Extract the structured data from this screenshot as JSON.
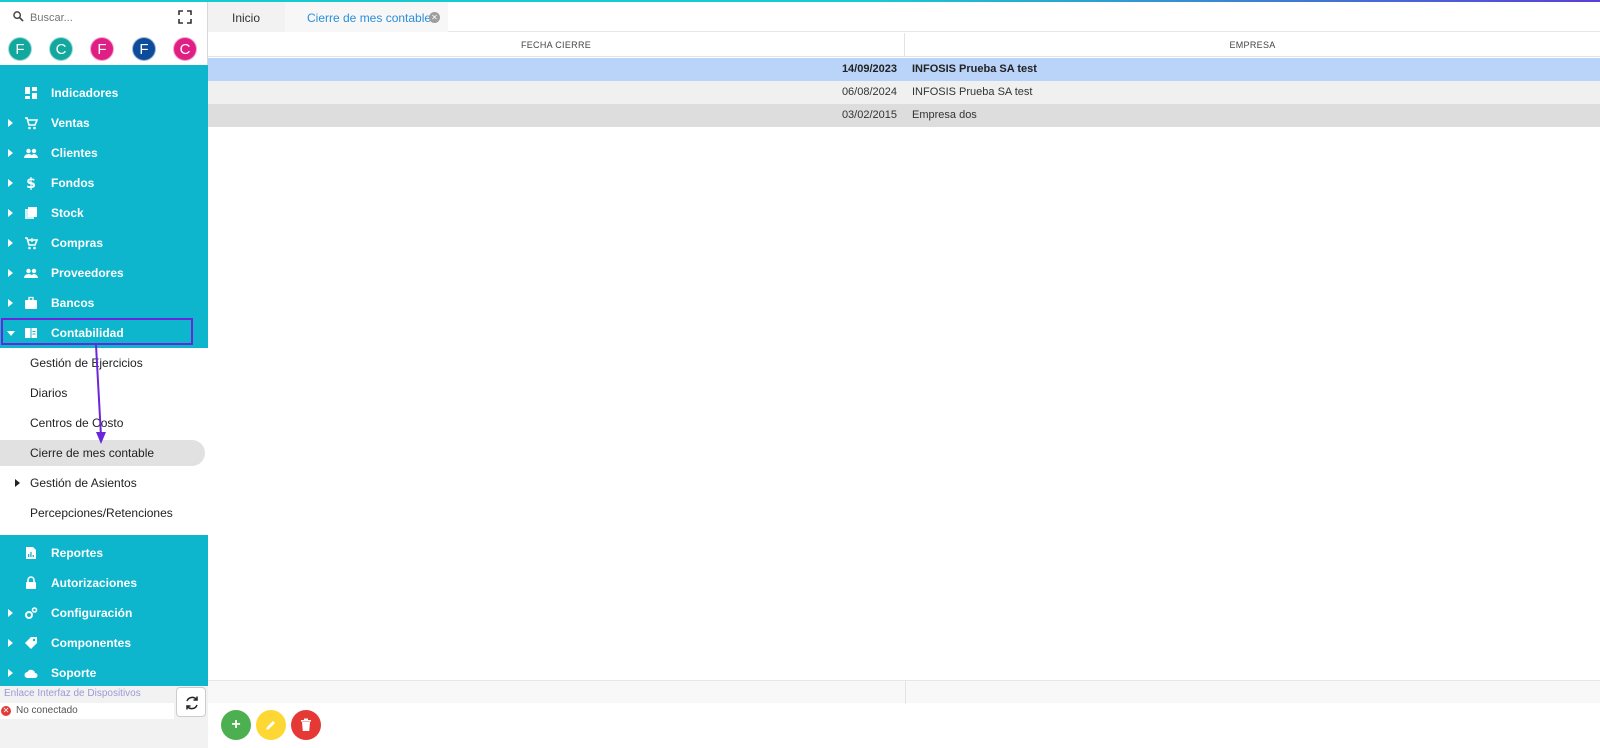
{
  "search": {
    "placeholder": "Buscar..."
  },
  "avatars": [
    {
      "letter": "F",
      "color": "#13a89e"
    },
    {
      "letter": "C",
      "color": "#13a89e"
    },
    {
      "letter": "F",
      "color": "#e01f84"
    },
    {
      "letter": "F",
      "color": "#0d4c9b"
    },
    {
      "letter": "C",
      "color": "#e01f84"
    }
  ],
  "menu": {
    "items": [
      {
        "label": "Indicadores",
        "icon": "dashboard-icon"
      },
      {
        "label": "Ventas",
        "icon": "cart-icon"
      },
      {
        "label": "Clientes",
        "icon": "people-icon"
      },
      {
        "label": "Fondos",
        "icon": "dollar-icon"
      },
      {
        "label": "Stock",
        "icon": "stack-icon"
      },
      {
        "label": "Compras",
        "icon": "cart-add-icon"
      },
      {
        "label": "Proveedores",
        "icon": "people-icon"
      },
      {
        "label": "Bancos",
        "icon": "briefcase-icon"
      },
      {
        "label": "Contabilidad",
        "icon": "book-icon"
      }
    ],
    "sub_items": [
      {
        "label": "Gestión de Ejercicios"
      },
      {
        "label": "Diarios"
      },
      {
        "label": "Centros de Costo"
      },
      {
        "label": "Cierre de mes contable"
      },
      {
        "label": "Gestión de Asientos"
      },
      {
        "label": "Percepciones/Retenciones"
      }
    ],
    "lower_items": [
      {
        "label": "Reportes",
        "icon": "report-icon"
      },
      {
        "label": "Autorizaciones",
        "icon": "lock-icon"
      },
      {
        "label": "Configuración",
        "icon": "gears-icon"
      },
      {
        "label": "Componentes",
        "icon": "tag-icon"
      },
      {
        "label": "Soporte",
        "icon": "cloud-icon"
      }
    ]
  },
  "device_link": {
    "title": "Enlace Interfaz de Dispositivos",
    "status": "No conectado"
  },
  "tabs": [
    {
      "label": "Inicio"
    },
    {
      "label": "Cierre de mes contable"
    }
  ],
  "grid": {
    "columns": [
      "FECHA CIERRE",
      "EMPRESA"
    ],
    "rows": [
      {
        "fecha": "14/09/2023",
        "empresa": "INFOSIS Prueba SA test"
      },
      {
        "fecha": "06/08/2024",
        "empresa": "INFOSIS Prueba SA test"
      },
      {
        "fecha": "03/02/2015",
        "empresa": "Empresa dos"
      }
    ]
  },
  "actions": {
    "add": "+",
    "edit": "✎",
    "delete": "🗑"
  },
  "colors": {
    "sidebar": "#0db6cd",
    "selected_row": "#b9d4f8",
    "highlight": "#6a27d9",
    "tab_active": "#2a8fd9"
  }
}
